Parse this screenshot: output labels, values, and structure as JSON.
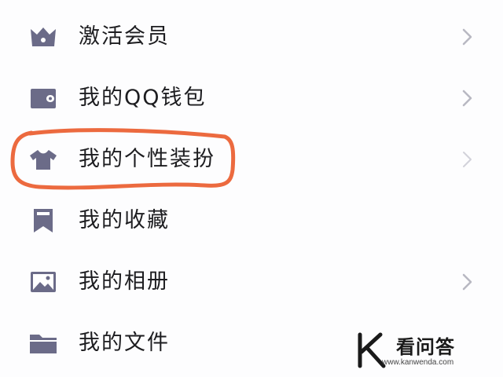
{
  "menu": {
    "items": [
      {
        "label": "激活会员",
        "icon": "crown-icon",
        "has_chevron": true
      },
      {
        "label": "我的QQ钱包",
        "icon": "wallet-icon",
        "has_chevron": true
      },
      {
        "label": "我的个性装扮",
        "icon": "tshirt-icon",
        "has_chevron": true
      },
      {
        "label": "我的收藏",
        "icon": "bookmark-icon",
        "has_chevron": false
      },
      {
        "label": "我的相册",
        "icon": "image-icon",
        "has_chevron": true
      },
      {
        "label": "我的文件",
        "icon": "folder-icon",
        "has_chevron": false
      }
    ]
  },
  "highlight": {
    "target": "我的个性装扮",
    "color": "#ec6a3f"
  },
  "watermark": {
    "title": "看问答",
    "url": "www.kanwenda.com",
    "logo": "k-logo-icon"
  },
  "colors": {
    "icon": "#6b6b88",
    "chevron": "#b8b8c2",
    "text": "#1d1d20"
  }
}
